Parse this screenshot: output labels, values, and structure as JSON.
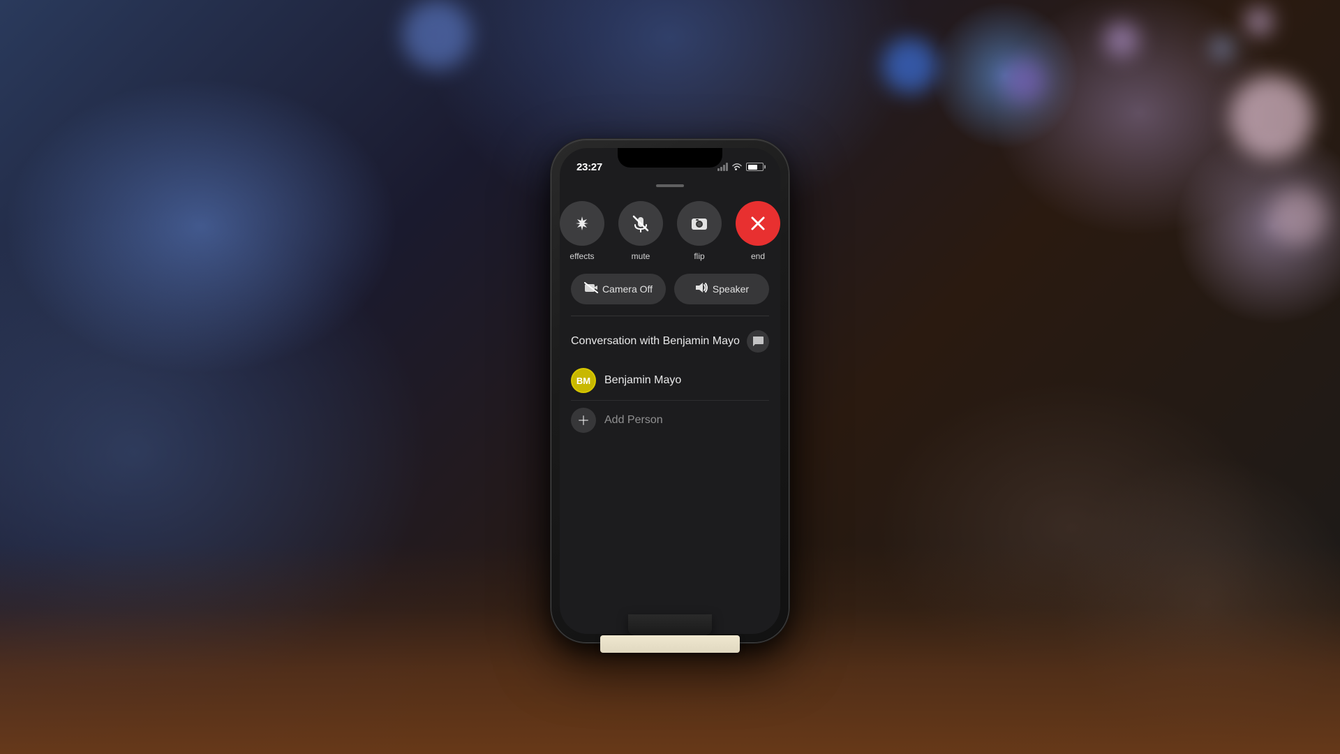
{
  "background": {
    "description": "Bokeh photography background with blue/purple tones and wooden table"
  },
  "phone": {
    "status_bar": {
      "time": "23:27",
      "signal_label": "signal",
      "wifi_label": "wifi",
      "battery_label": "battery"
    },
    "call_buttons": [
      {
        "id": "effects",
        "label": "effects",
        "icon": "✦",
        "color": "default"
      },
      {
        "id": "mute",
        "label": "mute",
        "icon": "🎤",
        "color": "default"
      },
      {
        "id": "flip",
        "label": "flip",
        "icon": "📷",
        "color": "default"
      },
      {
        "id": "end",
        "label": "end",
        "icon": "✕",
        "color": "red"
      }
    ],
    "wide_buttons": [
      {
        "id": "camera-off",
        "label": "Camera Off",
        "icon": "📹"
      },
      {
        "id": "speaker",
        "label": "Speaker",
        "icon": "🔊"
      }
    ],
    "conversation": {
      "title": "Conversation with Benjamin Mayo",
      "message_icon": "💬",
      "contact": {
        "name": "Benjamin Mayo",
        "initials": "BM",
        "avatar_color": "#c8b800"
      },
      "add_person_label": "Add Person"
    },
    "home_indicator": true
  }
}
